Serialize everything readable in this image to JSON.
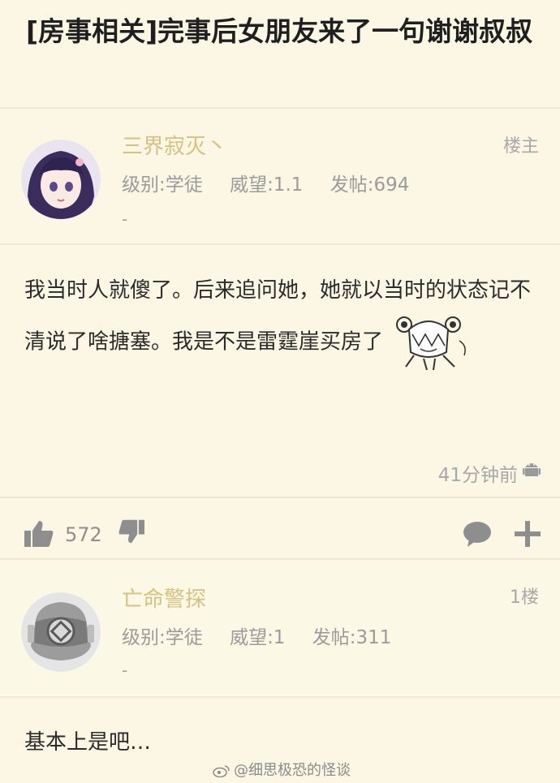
{
  "post": {
    "title": "[房事相关]完事后女朋友来了一句谢谢叔叔"
  },
  "op": {
    "username": "三界寂灭丶",
    "floor": "楼主",
    "level_label": "级别:学徒",
    "prestige_label": "威望:1.1",
    "posts_label": "发帖:694",
    "sub": "-",
    "content": "我当时人就傻了。后来追问她，她就以当时的状态记不清说了啥搪塞。我是不是雷霆崖买房了",
    "time": "41分钟前",
    "likes": "572"
  },
  "reply": {
    "username": "亡命警探",
    "floor": "1楼",
    "level_label": "级别:学徒",
    "prestige_label": "威望:1",
    "posts_label": "发帖:311",
    "sub": "-",
    "content": "基本上是吧…"
  },
  "watermark": "@细思极恐的怪谈",
  "icons": {
    "like": "thumbs-up-icon",
    "dislike": "thumbs-down-icon",
    "comment": "comment-bubble-icon",
    "add": "plus-icon",
    "device": "android-icon"
  },
  "colors": {
    "background": "#fbf7e4",
    "username": "#d7c181",
    "meta": "#9b9b9b"
  }
}
